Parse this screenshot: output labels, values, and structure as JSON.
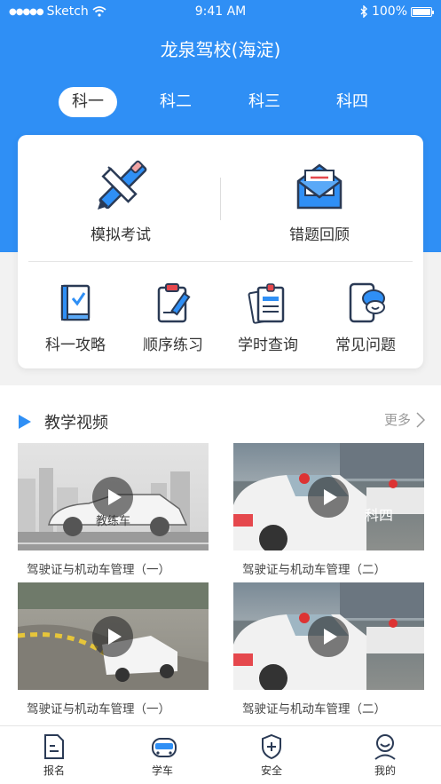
{
  "status_bar": {
    "carrier": "Sketch",
    "time": "9:41 AM",
    "battery": "100%"
  },
  "header": {
    "title": "龙泉驾校(海淀)"
  },
  "tabs": [
    {
      "label": "科一",
      "active": true
    },
    {
      "label": "科二"
    },
    {
      "label": "科三"
    },
    {
      "label": "科四"
    }
  ],
  "main_actions": [
    {
      "label": "模拟考试",
      "icon": "pencil-ruler-icon"
    },
    {
      "label": "错题回顾",
      "icon": "mail-icon"
    }
  ],
  "quick_actions": [
    {
      "label": "科一攻略",
      "icon": "book-icon"
    },
    {
      "label": "顺序练习",
      "icon": "clipboard-pen-icon"
    },
    {
      "label": "学时查询",
      "icon": "documents-icon"
    },
    {
      "label": "常见问题",
      "icon": "phone-chat-icon"
    }
  ],
  "videos_section": {
    "title": "教学视频",
    "more": "更多",
    "videos": [
      {
        "title": "驾驶证与机动车管理（一）",
        "overlay": "教练车"
      },
      {
        "title": "驾驶证与机动车管理（二）",
        "overlay": "科四"
      },
      {
        "title": "驾驶证与机动车管理（一）"
      },
      {
        "title": "驾驶证与机动车管理（二）"
      }
    ]
  },
  "tab_bar": [
    {
      "label": "报名",
      "icon": "document-icon"
    },
    {
      "label": "学车",
      "icon": "car-icon",
      "active": true
    },
    {
      "label": "安全",
      "icon": "shield-plus-icon"
    },
    {
      "label": "我的",
      "icon": "user-icon"
    }
  ],
  "colors": {
    "primary": "#2f8ff5",
    "accent_red": "#e5484d"
  }
}
